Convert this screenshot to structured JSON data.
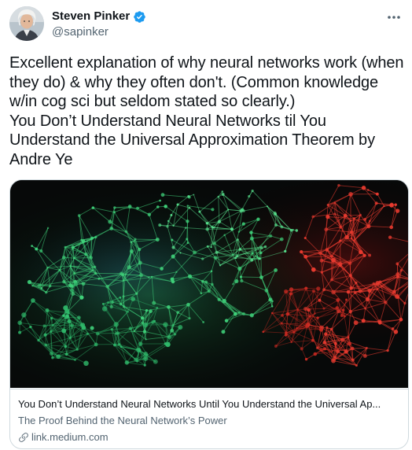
{
  "author": {
    "display_name": "Steven Pinker",
    "handle": "@sapinker",
    "verified": true,
    "avatar_icon": "profile-photo"
  },
  "tweet": {
    "text": "Excellent explanation of why neural networks work (when they do) & why they often don't. (Common knowledge w/in cog sci but seldom stated so clearly.)\nYou Don’t Understand Neural Networks til You Understand the Universal Approximation Theorem by Andre Ye"
  },
  "card": {
    "title": "You Don’t Understand Neural Networks Until You Understand the Universal Ap...",
    "description": "The Proof Behind the Neural Network’s Power",
    "domain": "link.medium.com",
    "image_icon": "neural-network-image"
  },
  "icons": {
    "verified": "verified-badge-icon",
    "more": "more-options-icon",
    "link": "link-icon"
  },
  "colors": {
    "verified_blue": "#1d9bf0",
    "text_primary": "#0f1419",
    "text_secondary": "#536471",
    "border": "#cfd9de"
  }
}
